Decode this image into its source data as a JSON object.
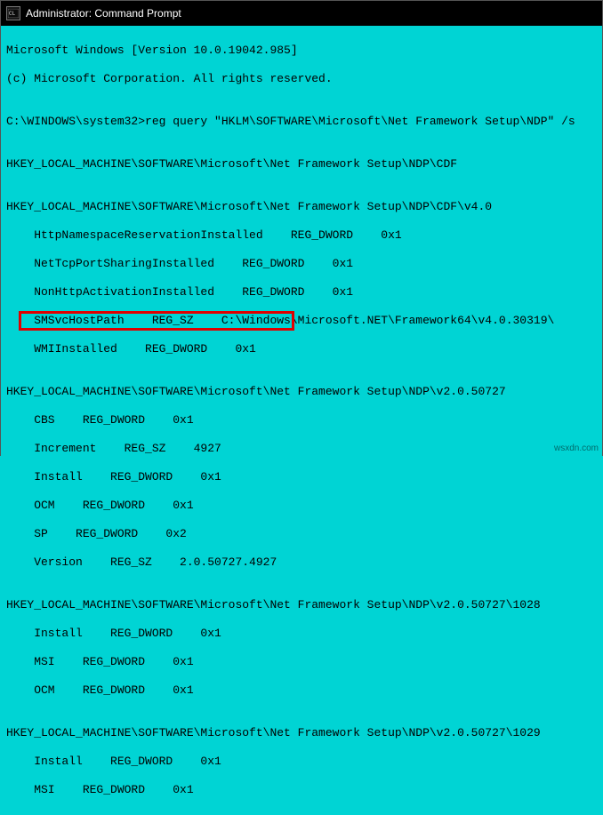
{
  "title": "Administrator: Command Prompt",
  "lines": {
    "l0": "Microsoft Windows [Version 10.0.19042.985]",
    "l1": "(c) Microsoft Corporation. All rights reserved.",
    "l2": "",
    "l3": "C:\\WINDOWS\\system32>reg query \"HKLM\\SOFTWARE\\Microsoft\\Net Framework Setup\\NDP\" /s",
    "l4": "",
    "l5": "HKEY_LOCAL_MACHINE\\SOFTWARE\\Microsoft\\Net Framework Setup\\NDP\\CDF",
    "l6": "",
    "l7": "HKEY_LOCAL_MACHINE\\SOFTWARE\\Microsoft\\Net Framework Setup\\NDP\\CDF\\v4.0",
    "l8": "    HttpNamespaceReservationInstalled    REG_DWORD    0x1",
    "l9": "    NetTcpPortSharingInstalled    REG_DWORD    0x1",
    "l10": "    NonHttpActivationInstalled    REG_DWORD    0x1",
    "l11": "    SMSvcHostPath    REG_SZ    C:\\Windows\\Microsoft.NET\\Framework64\\v4.0.30319\\",
    "l12": "    WMIInstalled    REG_DWORD    0x1",
    "l13": "",
    "l14": "HKEY_LOCAL_MACHINE\\SOFTWARE\\Microsoft\\Net Framework Setup\\NDP\\v2.0.50727",
    "l15": "    CBS    REG_DWORD    0x1",
    "l16": "    Increment    REG_SZ    4927",
    "l17": "    Install    REG_DWORD    0x1",
    "l18": "    OCM    REG_DWORD    0x1",
    "l19": "    SP    REG_DWORD    0x2",
    "l20": "    Version    REG_SZ    2.0.50727.4927",
    "l21": "",
    "l22": "HKEY_LOCAL_MACHINE\\SOFTWARE\\Microsoft\\Net Framework Setup\\NDP\\v2.0.50727\\1028",
    "l23": "    Install    REG_DWORD    0x1",
    "l24": "    MSI    REG_DWORD    0x1",
    "l25": "    OCM    REG_DWORD    0x1",
    "l26": "",
    "l27": "HKEY_LOCAL_MACHINE\\SOFTWARE\\Microsoft\\Net Framework Setup\\NDP\\v2.0.50727\\1029",
    "l28": "    Install    REG_DWORD    0x1",
    "l29": "    MSI    REG_DWORD    0x1"
  },
  "watermark": "wsxdn.com"
}
